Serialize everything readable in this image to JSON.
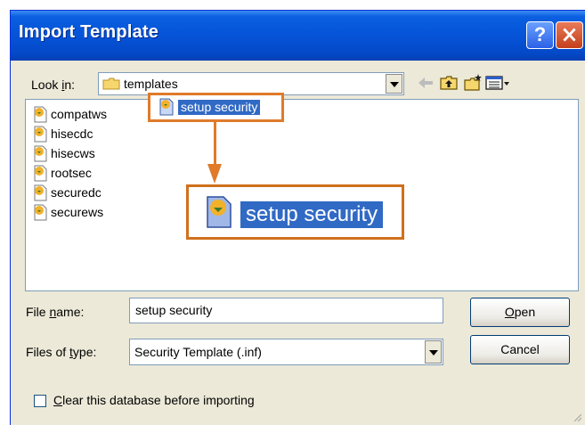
{
  "window": {
    "title": "Import Template",
    "help_label": "?"
  },
  "lookin": {
    "label_prefix": "Look ",
    "label_accel": "i",
    "label_suffix": "n:",
    "value": "templates"
  },
  "toolbar": {
    "icons": [
      "back-arrow-icon",
      "up-folder-icon",
      "new-folder-icon",
      "views-menu-icon"
    ]
  },
  "files": [
    {
      "name": "compatws"
    },
    {
      "name": "hisecdc"
    },
    {
      "name": "hisecws"
    },
    {
      "name": "rootsec"
    },
    {
      "name": "securedc"
    },
    {
      "name": "securews"
    },
    {
      "name": "setup security",
      "selected": true
    }
  ],
  "callout": {
    "zoom_text": "setup security",
    "accent_color": "#e07b2a"
  },
  "filename": {
    "label_prefix": "File ",
    "label_accel": "n",
    "label_suffix": "ame:",
    "value": "setup security"
  },
  "filetype": {
    "label_prefix": "Files of ",
    "label_accel": "t",
    "label_suffix": "ype:",
    "value": "Security Template (.inf)"
  },
  "buttons": {
    "open_accel": "O",
    "open_rest": "pen",
    "cancel": "Cancel"
  },
  "clear_db": {
    "accel": "C",
    "rest": "lear this database before importing",
    "checked": false
  },
  "colors": {
    "titlebar": "#0553d7",
    "selection": "#316ac5",
    "dialog_bg": "#ece9d8"
  }
}
